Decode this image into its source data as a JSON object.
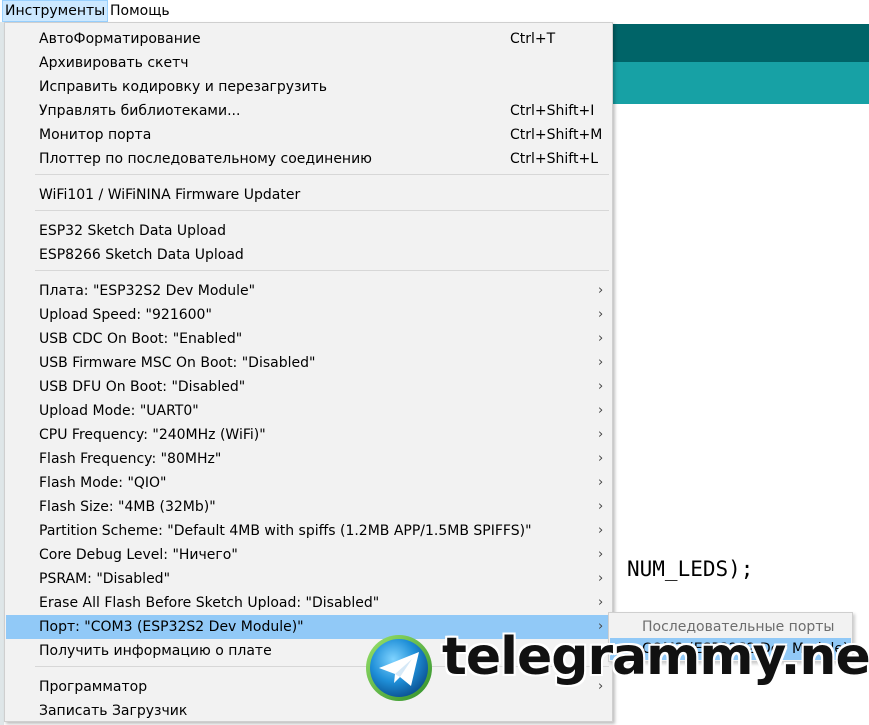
{
  "menubar": {
    "items": [
      {
        "label": "Инструменты"
      },
      {
        "label": "Помощь"
      }
    ]
  },
  "code": {
    "visible_fragment": "NUM_LEDS);"
  },
  "menu": {
    "items": [
      {
        "label": "АвтоФорматирование",
        "shortcut": "Ctrl+T"
      },
      {
        "label": "Архивировать скетч",
        "shortcut": ""
      },
      {
        "label": "Исправить кодировку и перезагрузить",
        "shortcut": ""
      },
      {
        "label": "Управлять библиотеками...",
        "shortcut": "Ctrl+Shift+I"
      },
      {
        "label": "Монитор порта",
        "shortcut": "Ctrl+Shift+M"
      },
      {
        "label": "Плоттер по последовательному соединению",
        "shortcut": "Ctrl+Shift+L"
      },
      {
        "label": "WiFi101 / WiFiNINA Firmware Updater",
        "shortcut": ""
      },
      {
        "label": "ESP32 Sketch Data Upload",
        "shortcut": ""
      },
      {
        "label": "ESP8266 Sketch Data Upload",
        "shortcut": ""
      },
      {
        "label": "Плата: \"ESP32S2 Dev Module\"",
        "submenu": true
      },
      {
        "label": "Upload Speed: \"921600\"",
        "submenu": true
      },
      {
        "label": "USB CDC On Boot: \"Enabled\"",
        "submenu": true
      },
      {
        "label": "USB Firmware MSC On Boot: \"Disabled\"",
        "submenu": true
      },
      {
        "label": "USB DFU On Boot: \"Disabled\"",
        "submenu": true
      },
      {
        "label": "Upload Mode: \"UART0\"",
        "submenu": true
      },
      {
        "label": "CPU Frequency: \"240MHz (WiFi)\"",
        "submenu": true
      },
      {
        "label": "Flash Frequency: \"80MHz\"",
        "submenu": true
      },
      {
        "label": "Flash Mode: \"QIO\"",
        "submenu": true
      },
      {
        "label": "Flash Size: \"4MB (32Mb)\"",
        "submenu": true
      },
      {
        "label": "Partition Scheme: \"Default 4MB with spiffs (1.2MB APP/1.5MB SPIFFS)\"",
        "submenu": true
      },
      {
        "label": "Core Debug Level: \"Ничего\"",
        "submenu": true
      },
      {
        "label": "PSRAM: \"Disabled\"",
        "submenu": true
      },
      {
        "label": "Erase All Flash Before Sketch Upload: \"Disabled\"",
        "submenu": true
      },
      {
        "label": "Порт: \"COM3 (ESP32S2 Dev Module)\"",
        "submenu": true,
        "highlighted": true
      },
      {
        "label": "Получить информацию о плате",
        "shortcut": ""
      },
      {
        "label": "Программатор",
        "submenu": true
      },
      {
        "label": "Записать Загрузчик",
        "shortcut": ""
      }
    ],
    "submenu_arrow": "›"
  },
  "port_submenu": {
    "header": "Последовательные порты",
    "check_glyph": "✓",
    "selected_port": "COM3 (ESP32S2 Dev Module)"
  },
  "watermark": {
    "text": "telegrammy.net"
  },
  "colors": {
    "highlight": "#91c9f7",
    "menu_bg": "#f2f2f2",
    "ide_dark_teal": "#006468",
    "ide_light_teal": "#17a1a5"
  }
}
